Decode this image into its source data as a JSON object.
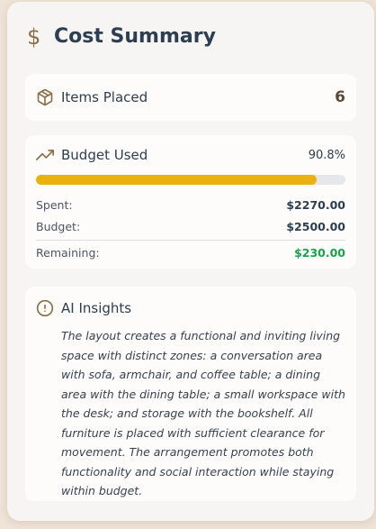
{
  "header": {
    "icon": "dollar-sign-icon",
    "title": "Cost Summary"
  },
  "items": {
    "icon": "package-icon",
    "label": "Items Placed",
    "count": "6"
  },
  "budget": {
    "icon": "trending-up-icon",
    "label": "Budget Used",
    "percent_text": "90.8%",
    "percent_value": 90.8,
    "bar_color": "#e9b20c",
    "spent_label": "Spent:",
    "spent_value": "$2270.00",
    "budget_label": "Budget:",
    "budget_value": "$2500.00",
    "remaining_label": "Remaining:",
    "remaining_value": "$230.00",
    "remaining_color": "#16a34a"
  },
  "insights": {
    "icon": "alert-circle-icon",
    "title": "AI Insights",
    "text": "The layout creates a functional and inviting living space with distinct zones: a conversation area with sofa, armchair, and coffee table; a dining area with the dining table; a small workspace with the desk; and storage with the bookshelf. All furniture is placed with sufficient clearance for movement. The arrangement promotes both functionality and social interaction while staying within budget."
  }
}
